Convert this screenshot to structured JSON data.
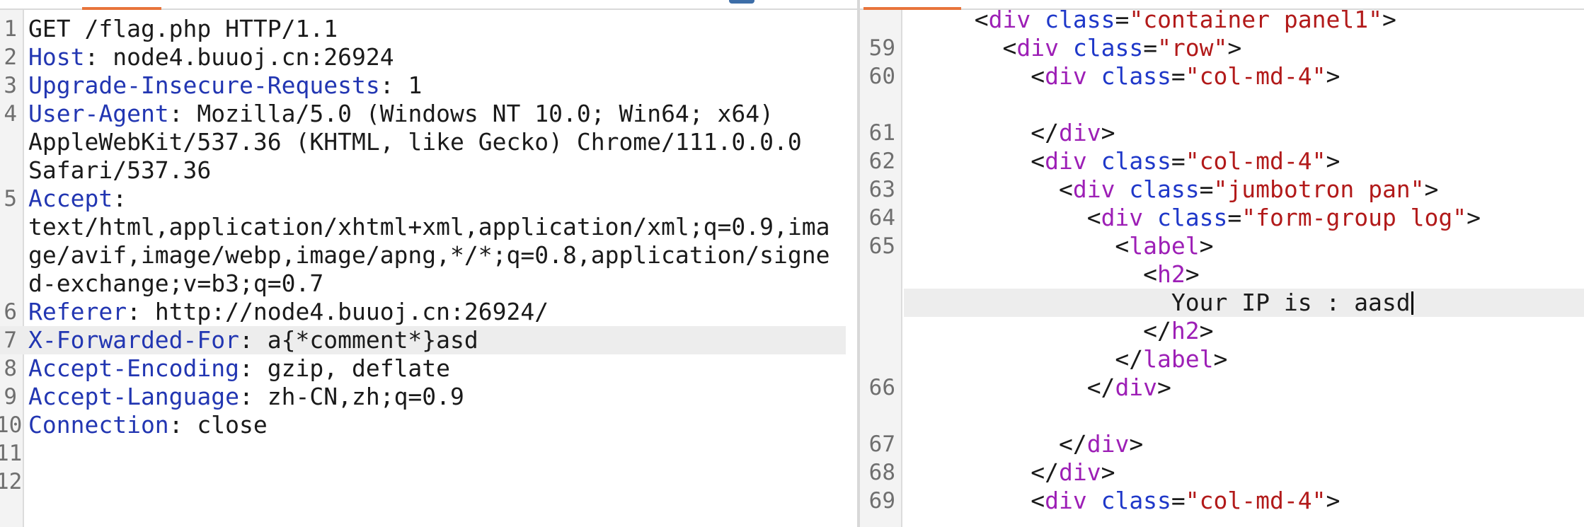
{
  "request": {
    "lines": [
      {
        "num": "1",
        "key": "",
        "sep": "",
        "value": "GET /flag.php HTTP/1.1"
      },
      {
        "num": "2",
        "key": "Host",
        "sep": ":",
        "value": " node4.buuoj.cn:26924"
      },
      {
        "num": "3",
        "key": "Upgrade-Insecure-Requests",
        "sep": ":",
        "value": " 1"
      },
      {
        "num": "4",
        "key": "User-Agent",
        "sep": ":",
        "value": " Mozilla/5.0 (Windows NT 10.0; Win64; x64)"
      },
      {
        "num": "",
        "key": "",
        "sep": "",
        "value": "AppleWebKit/537.36 (KHTML, like Gecko) Chrome/111.0.0.0"
      },
      {
        "num": "",
        "key": "",
        "sep": "",
        "value": "Safari/537.36"
      },
      {
        "num": "5",
        "key": "Accept",
        "sep": ":",
        "value": ""
      },
      {
        "num": "",
        "key": "",
        "sep": "",
        "value": "text/html,application/xhtml+xml,application/xml;q=0.9,ima"
      },
      {
        "num": "",
        "key": "",
        "sep": "",
        "value": "ge/avif,image/webp,image/apng,*/*;q=0.8,application/signe"
      },
      {
        "num": "",
        "key": "",
        "sep": "",
        "value": "d-exchange;v=b3;q=0.7"
      },
      {
        "num": "6",
        "key": "Referer",
        "sep": ":",
        "value": " http://node4.buuoj.cn:26924/"
      },
      {
        "num": "7",
        "key": "X-Forwarded-For",
        "sep": ":",
        "value": " a{*comment*}asd"
      },
      {
        "num": "8",
        "key": "Accept-Encoding",
        "sep": ":",
        "value": " gzip, deflate"
      },
      {
        "num": "9",
        "key": "Accept-Language",
        "sep": ":",
        "value": " zh-CN,zh;q=0.9"
      },
      {
        "num": "10",
        "key": "Connection",
        "sep": ":",
        "value": " close"
      },
      {
        "num": "11",
        "key": "",
        "sep": "",
        "value": ""
      },
      {
        "num": "12",
        "key": "",
        "sep": "",
        "value": ""
      }
    ]
  },
  "response": {
    "lines": [
      {
        "num": "",
        "indent": "  ",
        "parts": [
          [
            "p",
            "<"
          ],
          [
            "tag",
            "div"
          ],
          [
            "p",
            " "
          ],
          [
            "attr",
            "class"
          ],
          [
            "p",
            "="
          ],
          [
            "val",
            "\"container panel1\""
          ],
          [
            "p",
            ">"
          ]
        ]
      },
      {
        "num": "59",
        "indent": "    ",
        "parts": [
          [
            "p",
            "<"
          ],
          [
            "tag",
            "div"
          ],
          [
            "p",
            " "
          ],
          [
            "attr",
            "class"
          ],
          [
            "p",
            "="
          ],
          [
            "val",
            "\"row\""
          ],
          [
            "p",
            ">"
          ]
        ]
      },
      {
        "num": "60",
        "indent": "      ",
        "parts": [
          [
            "p",
            "<"
          ],
          [
            "tag",
            "div"
          ],
          [
            "p",
            " "
          ],
          [
            "attr",
            "class"
          ],
          [
            "p",
            "="
          ],
          [
            "val",
            "\"col-md-4\""
          ],
          [
            "p",
            ">"
          ]
        ]
      },
      {
        "num": "",
        "indent": "",
        "parts": []
      },
      {
        "num": "61",
        "indent": "      ",
        "parts": [
          [
            "p",
            "</"
          ],
          [
            "tag",
            "div"
          ],
          [
            "p",
            ">"
          ]
        ]
      },
      {
        "num": "62",
        "indent": "      ",
        "parts": [
          [
            "p",
            "<"
          ],
          [
            "tag",
            "div"
          ],
          [
            "p",
            " "
          ],
          [
            "attr",
            "class"
          ],
          [
            "p",
            "="
          ],
          [
            "val",
            "\"col-md-4\""
          ],
          [
            "p",
            ">"
          ]
        ]
      },
      {
        "num": "63",
        "indent": "        ",
        "parts": [
          [
            "p",
            "<"
          ],
          [
            "tag",
            "div"
          ],
          [
            "p",
            " "
          ],
          [
            "attr",
            "class"
          ],
          [
            "p",
            "="
          ],
          [
            "val",
            "\"jumbotron pan\""
          ],
          [
            "p",
            ">"
          ]
        ]
      },
      {
        "num": "64",
        "indent": "          ",
        "parts": [
          [
            "p",
            "<"
          ],
          [
            "tag",
            "div"
          ],
          [
            "p",
            " "
          ],
          [
            "attr",
            "class"
          ],
          [
            "p",
            "="
          ],
          [
            "val",
            "\"form-group log\""
          ],
          [
            "p",
            ">"
          ]
        ]
      },
      {
        "num": "65",
        "indent": "            ",
        "parts": [
          [
            "p",
            "<"
          ],
          [
            "tag",
            "label"
          ],
          [
            "p",
            ">"
          ]
        ]
      },
      {
        "num": "",
        "indent": "              ",
        "parts": [
          [
            "p",
            "<"
          ],
          [
            "tag",
            "h2"
          ],
          [
            "p",
            ">"
          ]
        ]
      },
      {
        "num": "",
        "indent": "                ",
        "parts": [
          [
            "p",
            "Your IP is : aasd"
          ]
        ],
        "caret": true
      },
      {
        "num": "",
        "indent": "              ",
        "parts": [
          [
            "p",
            "</"
          ],
          [
            "tag",
            "h2"
          ],
          [
            "p",
            ">"
          ]
        ]
      },
      {
        "num": "",
        "indent": "            ",
        "parts": [
          [
            "p",
            "</"
          ],
          [
            "tag",
            "label"
          ],
          [
            "p",
            ">"
          ]
        ]
      },
      {
        "num": "66",
        "indent": "          ",
        "parts": [
          [
            "p",
            "</"
          ],
          [
            "tag",
            "div"
          ],
          [
            "p",
            ">"
          ]
        ]
      },
      {
        "num": "",
        "indent": "",
        "parts": []
      },
      {
        "num": "67",
        "indent": "        ",
        "parts": [
          [
            "p",
            "</"
          ],
          [
            "tag",
            "div"
          ],
          [
            "p",
            ">"
          ]
        ]
      },
      {
        "num": "68",
        "indent": "      ",
        "parts": [
          [
            "p",
            "</"
          ],
          [
            "tag",
            "div"
          ],
          [
            "p",
            ">"
          ]
        ]
      },
      {
        "num": "69",
        "indent": "      ",
        "parts": [
          [
            "p",
            "<"
          ],
          [
            "tag",
            "div"
          ],
          [
            "p",
            " "
          ],
          [
            "attr",
            "class"
          ],
          [
            "p",
            "="
          ],
          [
            "val",
            "\"col-md-4\""
          ],
          [
            "p",
            ">"
          ]
        ]
      }
    ]
  },
  "colors": {
    "header_key": "#2236b2",
    "tag_name": "#9d1fb6",
    "attr_name": "#1f38c9",
    "attr_value": "#b21a1a",
    "active_tab": "#e8743b"
  }
}
